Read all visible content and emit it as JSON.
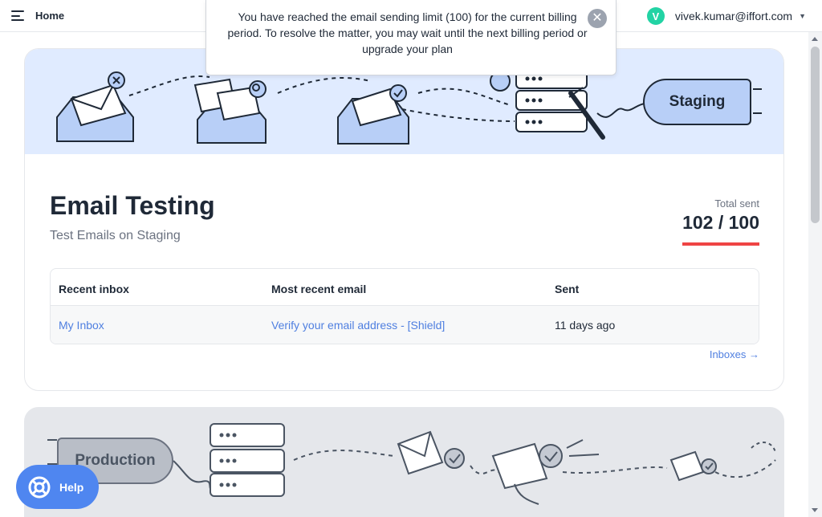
{
  "topbar": {
    "breadcrumb": "Home",
    "account": {
      "avatar_letter": "V",
      "email": "vivek.kumar@iffort.com"
    }
  },
  "toast": {
    "message": "You have reached the email sending limit (100) for the current billing period. To resolve the matter, you may wait until the next billing period or upgrade your plan"
  },
  "staging": {
    "banner_label": "Staging",
    "title": "Email Testing",
    "subtitle": "Test Emails on Staging",
    "total_sent_label": "Total sent",
    "total_sent_value": "102 / 100",
    "table": {
      "headers": [
        "Recent inbox",
        "Most recent email",
        "Sent"
      ],
      "rows": [
        {
          "inbox": "My Inbox",
          "email": "Verify your email address - [Shield]",
          "sent": "11 days ago"
        }
      ]
    },
    "inboxes_link": "Inboxes →"
  },
  "production": {
    "banner_label": "Production"
  },
  "help": {
    "label": "Help"
  },
  "colors": {
    "accent": "#4f86f0",
    "link": "#4f7fe0",
    "limit_bar": "#ef4444",
    "avatar": "#22d3a4",
    "staging_banner": "#e0ebff"
  }
}
